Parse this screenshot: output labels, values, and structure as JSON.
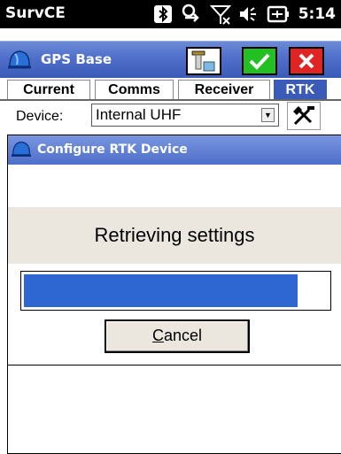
{
  "status_bar": {
    "app_name": "SurvCE",
    "time": "5:14",
    "icons": [
      "bluetooth-icon",
      "sync-icon",
      "no-signal-icon",
      "volume-icon",
      "battery-icon"
    ]
  },
  "title_bar": {
    "title": "GPS Base",
    "buttons": [
      "device-config-icon",
      "ok-check-icon",
      "close-x-icon"
    ]
  },
  "tabs": [
    {
      "label": "Current",
      "active": false
    },
    {
      "label": "Comms",
      "active": false
    },
    {
      "label": "Receiver",
      "active": false
    },
    {
      "label": "RTK",
      "active": true
    }
  ],
  "device": {
    "label": "Device:",
    "value": "Internal UHF"
  },
  "dialog": {
    "title": "Configure RTK Device",
    "message": "Retrieving settings",
    "progress_fraction": 0.9,
    "cancel_label": "Cancel"
  },
  "colors": {
    "accent": "#3b5bb8",
    "progress": "#2e66d2",
    "ok": "#22c022",
    "close": "#e02424"
  }
}
